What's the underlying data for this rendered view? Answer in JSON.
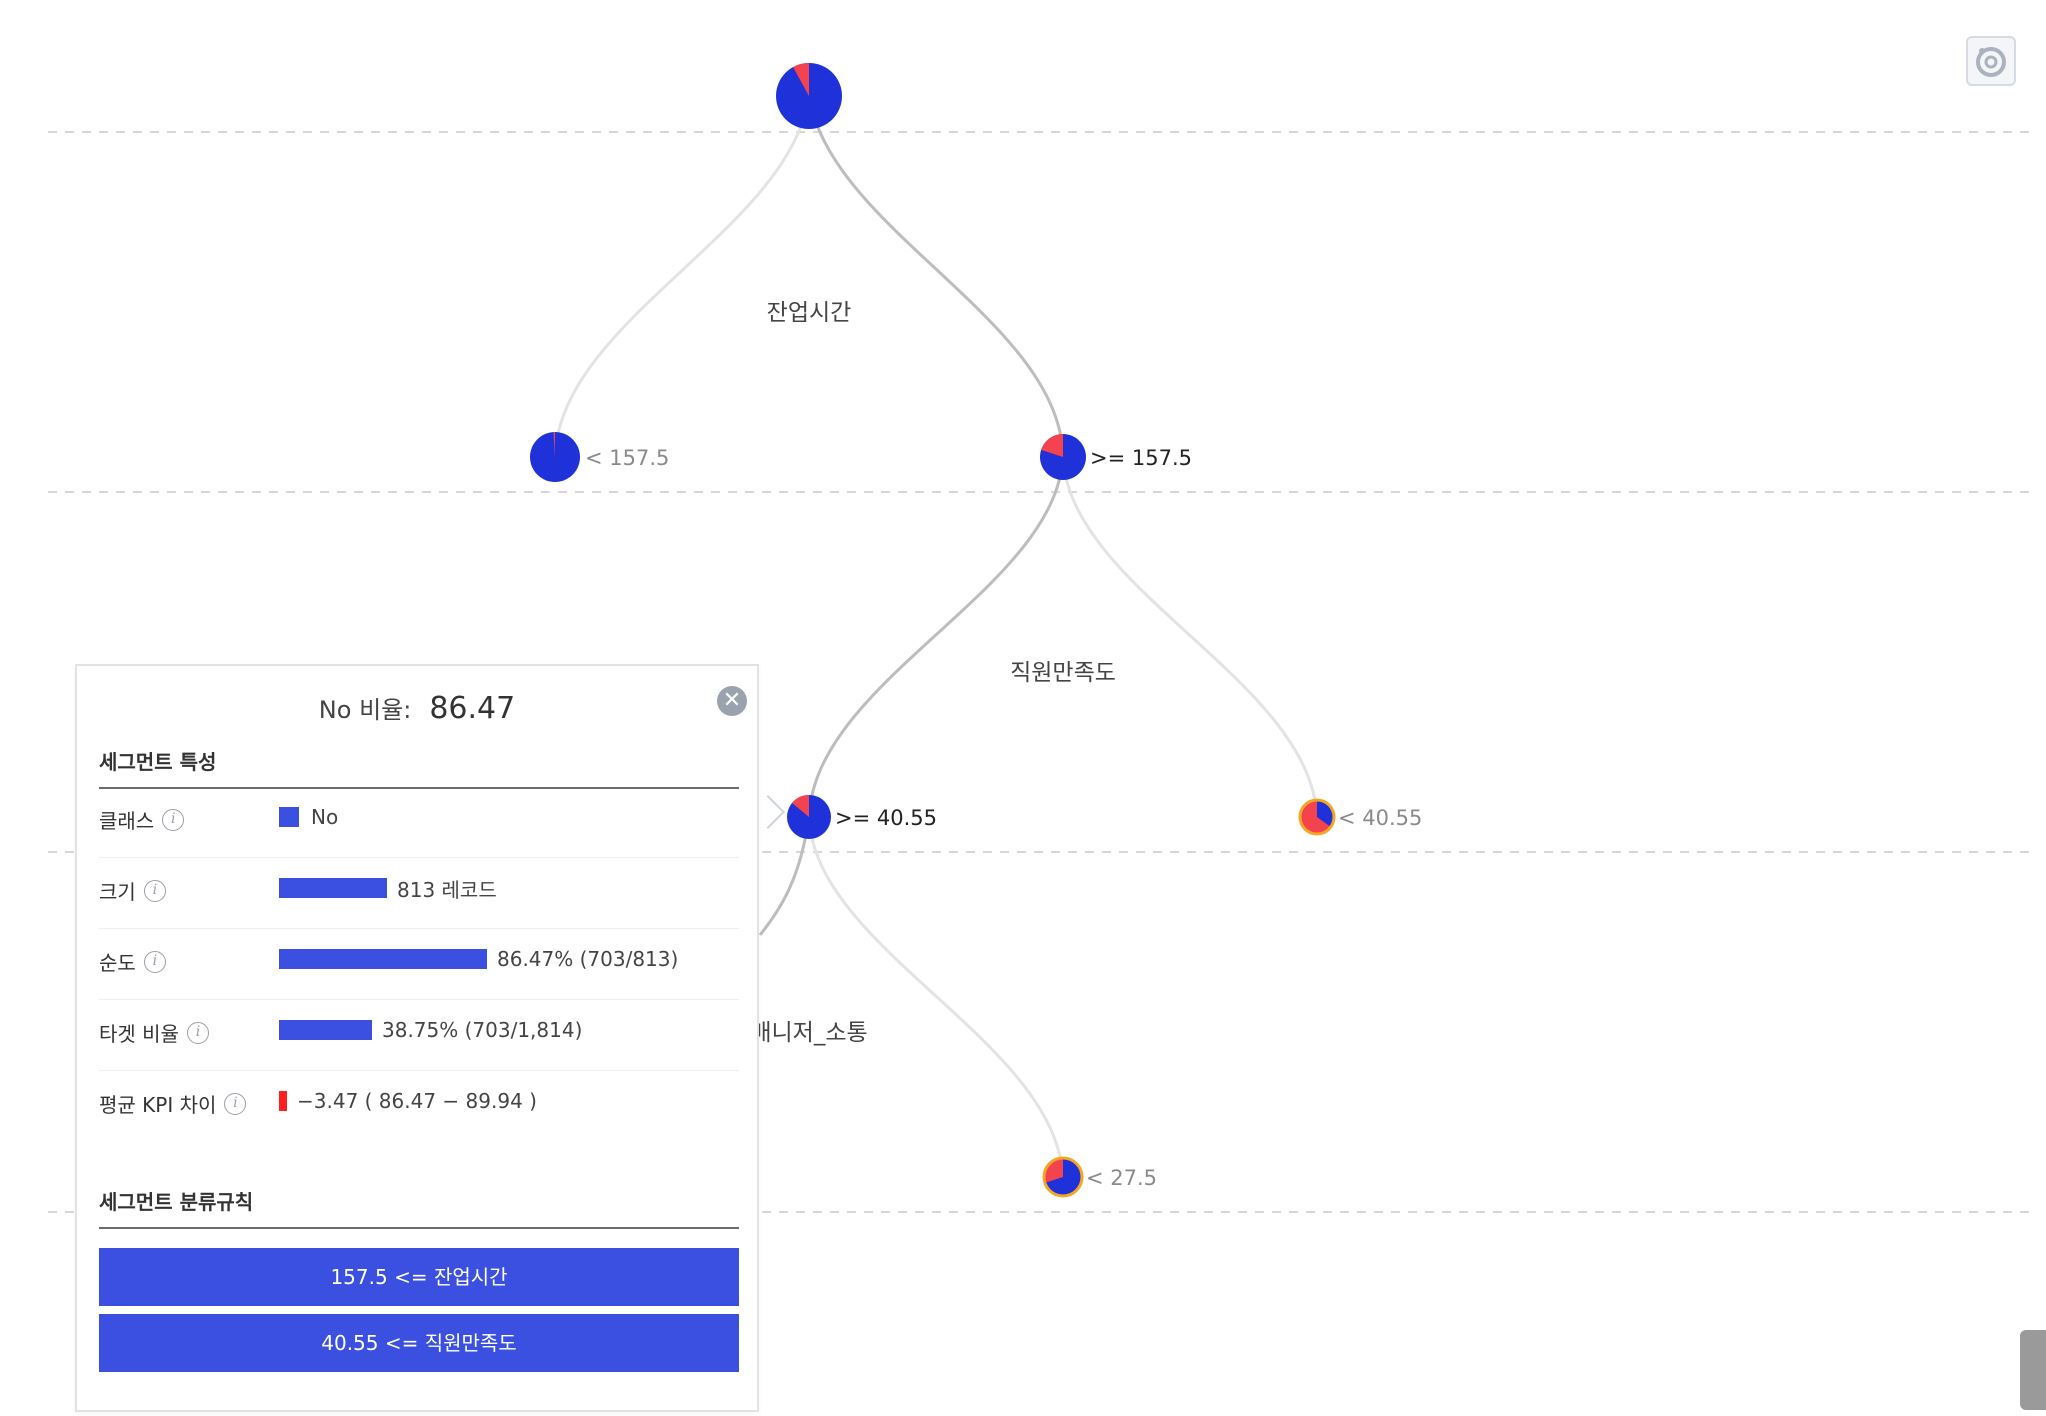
{
  "tree": {
    "root": {
      "pie_minority_fraction": 0.08
    },
    "level1": {
      "split_feature": "잔업시간",
      "left_branch": "< 157.5",
      "right_branch": ">= 157.5",
      "left_pie_fraction": 0.01,
      "right_pie_fraction": 0.2
    },
    "level2": {
      "split_feature": "직원만족도",
      "left_branch": ">= 40.55",
      "right_branch": "< 40.55",
      "left_pie_fraction": 0.14,
      "right_pie_fraction": 0.65
    },
    "level3": {
      "split_feature": "매니저_소통",
      "right_branch": "< 27.5",
      "right_pie_fraction": 0.3
    },
    "colors": {
      "majority": "#1f32d9",
      "minority": "#f3434f",
      "edge_active": "#bdbdbd",
      "edge_inactive": "#e3e3e3",
      "leaf_ring": "#f5a623"
    }
  },
  "panel": {
    "header_label": "No 비율:",
    "header_value": "86.47",
    "close_label": "✕",
    "section_features": "세그먼트 특성",
    "rows": {
      "class": {
        "label": "클래스",
        "value": "No"
      },
      "size": {
        "label": "크기",
        "value": "813 레코드",
        "bar_fraction": 0.45
      },
      "purity": {
        "label": "순도",
        "value": "86.47% (703/813)",
        "bar_fraction": 0.8647
      },
      "target_ratio": {
        "label": "타겟 비율",
        "value": "38.75% (703/1,814)",
        "bar_fraction": 0.3875
      },
      "kpi_diff": {
        "label": "평균 KPI 차이",
        "value": "−3.47 ( 86.47 − 89.94 )"
      }
    },
    "section_rules": "세그먼트 분류규칙",
    "rules": [
      "157.5 <= 잔업시간",
      "40.55 <= 직원만족도"
    ]
  },
  "icons": {
    "settings": "settings-icon",
    "info": "info-icon",
    "close": "close-icon"
  }
}
